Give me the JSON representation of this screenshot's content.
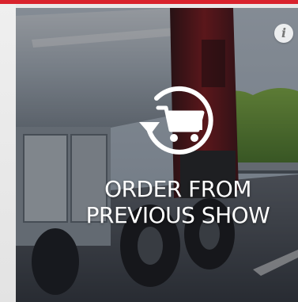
{
  "tile": {
    "label_line1": "ORDER FROM",
    "label_line2": "PREVIOUS SHOW",
    "info_glyph": "i",
    "icon": "cart-reorder-icon",
    "background": "tanker-truck-on-highway-photo"
  },
  "colors": {
    "top_bar": "#d9232d",
    "label": "#ffffff"
  }
}
